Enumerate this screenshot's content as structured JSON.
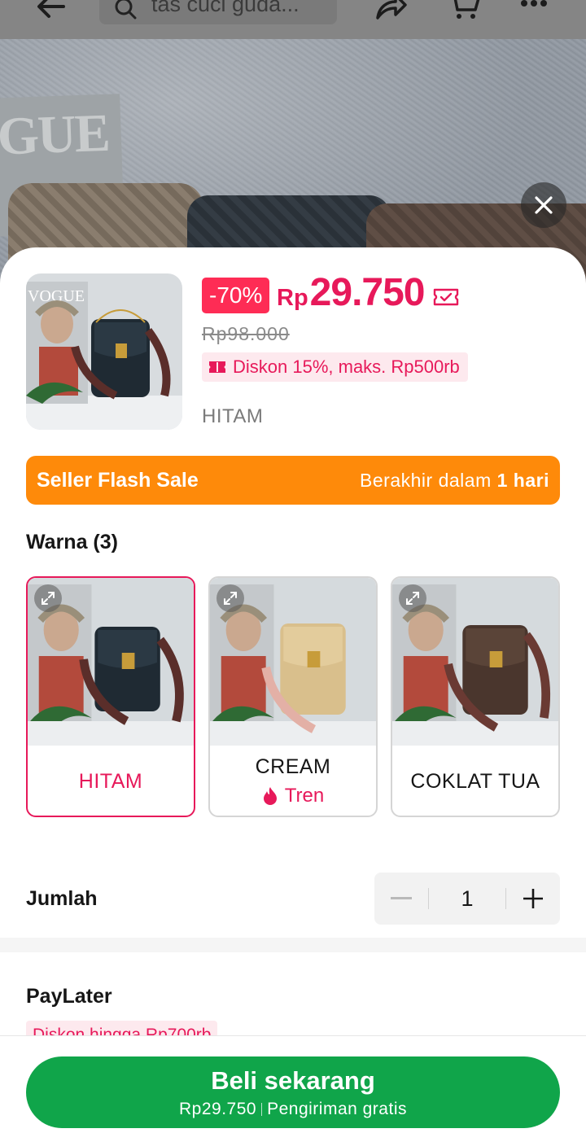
{
  "topbar": {
    "search_text": "tas cuci guda...",
    "icons": [
      "back-arrow-icon",
      "search-icon",
      "share-icon",
      "cart-icon",
      "more-icon"
    ]
  },
  "product": {
    "discount": "-70%",
    "currency": "Rp",
    "price": "29.750",
    "original_price": "Rp98.000",
    "promo": "Diskon 15%, maks. Rp500rb",
    "selected_variant": "HITAM"
  },
  "flash_sale": {
    "title": "Seller Flash Sale",
    "ends_prefix": "Berakhir dalam",
    "ends_value": "1 hari"
  },
  "colors": {
    "title": "Warna (3)",
    "options": [
      {
        "label": "HITAM",
        "selected": true
      },
      {
        "label": "CREAM",
        "badge": "Tren"
      },
      {
        "label": "COKLAT TUA"
      }
    ]
  },
  "quantity": {
    "title": "Jumlah",
    "value": "1"
  },
  "paylater": {
    "title": "PayLater",
    "promo": "Diskon hingga Rp700rb"
  },
  "buy": {
    "title": "Beli sekarang",
    "price": "Rp29.750",
    "shipping": "Pengiriman gratis"
  },
  "colors_theme": {
    "accent_pink": "#e7195a",
    "flash_orange": "#fe8a0a",
    "buy_green": "#10a54a"
  }
}
